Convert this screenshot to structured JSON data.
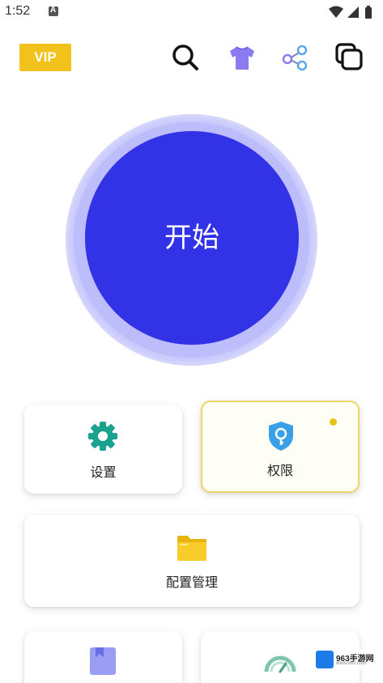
{
  "status_bar": {
    "time": "1:52",
    "icons": [
      "a-notification-icon",
      "wifi-icon",
      "signal-icon",
      "battery-icon"
    ]
  },
  "top_bar": {
    "vip_label": "VIP",
    "icons": [
      "search-icon",
      "shirt-icon",
      "share-icon",
      "copy-icon"
    ]
  },
  "start_button": {
    "label": "开始"
  },
  "cards": {
    "settings": {
      "label": "设置",
      "icon": "gear-icon"
    },
    "permissions": {
      "label": "权限",
      "icon": "shield-key-icon",
      "has_dot": true
    },
    "config": {
      "label": "配置管理",
      "icon": "folder-icon"
    },
    "bottom_left": {
      "icon": "book-icon"
    },
    "bottom_right": {
      "icon": "speedometer-icon"
    }
  },
  "watermark": {
    "title": "963手游网",
    "subtitle": "www.963.com"
  },
  "colors": {
    "accent": "#3232e6",
    "vip": "#f2c21c",
    "settings_green": "#1aa28f",
    "shield_blue": "#3aa0e8",
    "folder_yellow": "#f5c518",
    "shirt_purple": "#8a7cf0"
  }
}
